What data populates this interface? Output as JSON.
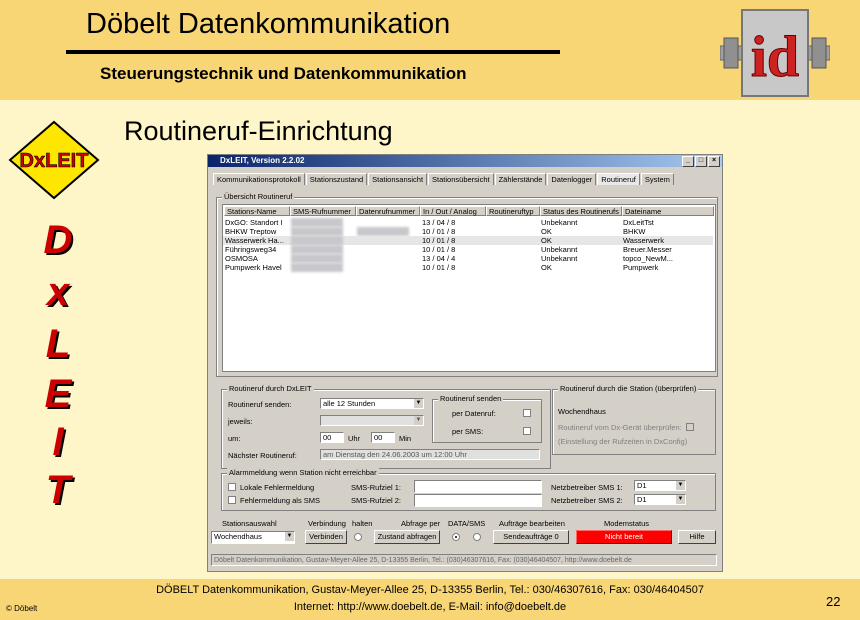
{
  "header": {
    "title": "Döbelt Datenkommunikation",
    "subtitle": "Steuerungstechnik und Datenkommunikation",
    "logo_text": "id"
  },
  "slide": {
    "title": "Routineruf-Einrichtung",
    "badge_text": "DxLEIT",
    "vertical_letters": [
      "D",
      "x",
      "L",
      "E",
      "I",
      "T"
    ]
  },
  "footer": {
    "line1": "DÖBELT Datenkommunikation, Gustav-Meyer-Allee 25, D-13355 Berlin, Tel.: 030/46307616, Fax: 030/46404507",
    "line2": "Internet: http://www.doebelt.de, E-Mail: info@doebelt.de",
    "copyright": "© Döbelt",
    "page": "22"
  },
  "window": {
    "title": "DxLEIT, Version 2.2.02",
    "controls": [
      "_",
      "□",
      "×"
    ],
    "tabs": [
      "Kommunikationsprotokoll",
      "Stationszustand",
      "Stationsansicht",
      "Stationsübersicht",
      "Zählerstände",
      "Datenlogger",
      "Routineruf",
      "System"
    ],
    "active_tab": "Routineruf",
    "overview": {
      "group_title": "Übersicht Routineruf",
      "columns": [
        "Stations-Name",
        "SMS-Rufnummer",
        "Datenrufnummer",
        "In / Out / Analog",
        "Routineruftyp",
        "Status des Routinerufs",
        "Dateiname"
      ],
      "rows": [
        {
          "name": "DxGO: Standort I",
          "io": "13 / 04 / 8",
          "status": "Unbekannt",
          "file": "DxLeitTst"
        },
        {
          "name": "BHKW Treptow",
          "io": "10 / 01 / 8",
          "status": "OK",
          "file": "BHKW"
        },
        {
          "name": "Wasserwerk Ha...",
          "io": "10 / 01 / 8",
          "status": "OK",
          "file": "Wasserwerk"
        },
        {
          "name": "Führingsweg34",
          "io": "10 / 01 / 8",
          "status": "Unbekannt",
          "file": "Breuer.Messer"
        },
        {
          "name": "OSMOSA",
          "io": "13 / 04 / 4",
          "status": "Unbekannt",
          "file": "topco_NewM..."
        },
        {
          "name": "Pumpwerk Havel",
          "io": "10 / 01 / 8",
          "status": "OK",
          "file": "Pumpwerk"
        }
      ]
    },
    "routineruf_dxleit": {
      "group_title": "Routineruf durch DxLEIT",
      "send_label": "Routineruf senden:",
      "send_value": "alle 12 Stunden",
      "each_label": "jeweils:",
      "each_value": "",
      "time_label": "um:",
      "hour_value": "00",
      "hour_unit": "Uhr",
      "min_value": "00",
      "min_unit": "Min",
      "next_label": "Nächster Routineruf:",
      "next_value": "am Dienstag den 24.06.2003 um 12:00 Uhr",
      "send_group_title": "Routineruf senden",
      "per_data_label": "per Datenruf:",
      "per_sms_label": "per SMS:"
    },
    "routineruf_station": {
      "group_title": "Routineruf durch die Station (überprüfen)",
      "weekend_title": "Wochendhaus",
      "check_label": "Routineruf vom Dx-Gerät überprüfen:",
      "hint": "(Einstellung der Rufzeiten in DxConfig)"
    },
    "alarm": {
      "group_title": "Alarmmeldung wenn Station nicht erreichbar",
      "local_error": "Lokale Fehlermeldung",
      "sms_error": "Fehlermeldung als SMS",
      "sms_target1_label": "SMS-Rufziel 1:",
      "sms_target2_label": "SMS-Rufziel 2:",
      "provider1_label": "Netzbetreiber SMS 1:",
      "provider2_label": "Netzbetreiber SMS 2:",
      "provider1_value": "D1",
      "provider2_value": "D1"
    },
    "bottom": {
      "station_select_label": "Stationsauswahl",
      "station_select_value": "Wochendhaus",
      "connection_label": "Verbindung",
      "hold_label": "halten",
      "connect_button": "Verbinden",
      "query_label": "Abfrage per",
      "data_sms_label": "DATA/SMS",
      "status_button": "Zustand abfragen",
      "orders_label": "Aufträge bearbeiten",
      "send_orders_button": "Sendeaufträge 0",
      "modem_label": "Modemstatus",
      "modem_status": "Nicht bereit",
      "help_button": "Hilfe"
    },
    "status_bar": "Döbelt Datenkommunikation, Gustav-Meyer-Allee 25, D-13355 Berlin, Tel.: (030)46307616, Fax: (030)46404507, http://www.doebelt.de"
  }
}
